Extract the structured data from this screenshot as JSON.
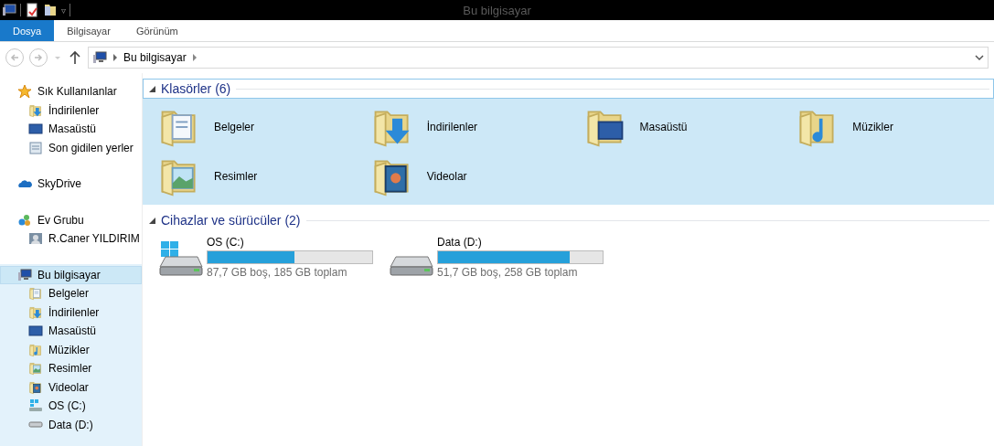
{
  "window": {
    "title": "Bu bilgisayar"
  },
  "quick_access": [
    "▿"
  ],
  "ribbon_tabs": [
    {
      "label": "Dosya",
      "selected": true
    },
    {
      "label": "Bilgisayar",
      "selected": false
    },
    {
      "label": "Görünüm",
      "selected": false
    }
  ],
  "address_bar": {
    "path": [
      "Bu bilgisayar"
    ]
  },
  "sidebar": {
    "sections": [
      {
        "label": "Sık Kullanılanlar",
        "kind": "star",
        "selected": false,
        "children": [
          {
            "label": "İndirilenler",
            "kind": "downloads",
            "selected": false
          },
          {
            "label": "Masaüstü",
            "kind": "desktop",
            "selected": false
          },
          {
            "label": "Son gidilen yerler",
            "kind": "recent",
            "selected": false
          }
        ]
      },
      {
        "label": "SkyDrive",
        "kind": "cloud",
        "selected": false
      },
      {
        "label": "Ev Grubu",
        "kind": "homegroup",
        "selected": false,
        "children": [
          {
            "label": "R.Caner YILDIRIM",
            "kind": "user",
            "selected": false
          }
        ]
      },
      {
        "label": "Bu bilgisayar",
        "kind": "computer",
        "selected": true,
        "children": [
          {
            "label": "Belgeler",
            "kind": "documents",
            "selected": false
          },
          {
            "label": "İndirilenler",
            "kind": "downloads",
            "selected": false
          },
          {
            "label": "Masaüstü",
            "kind": "desktop",
            "selected": false
          },
          {
            "label": "Müzikler",
            "kind": "music",
            "selected": false
          },
          {
            "label": "Resimler",
            "kind": "pictures",
            "selected": false
          },
          {
            "label": "Videolar",
            "kind": "videos",
            "selected": false
          },
          {
            "label": "OS (C:)",
            "kind": "windows-drive",
            "selected": false
          },
          {
            "label": "Data (D:)",
            "kind": "drive",
            "selected": false
          }
        ]
      }
    ]
  },
  "folders_group": {
    "title": "Klasörler (6)",
    "selected": true,
    "items": [
      {
        "label": "Belgeler",
        "kind": "documents",
        "selected": true
      },
      {
        "label": "İndirilenler",
        "kind": "downloads",
        "selected": true
      },
      {
        "label": "Masaüstü",
        "kind": "desktop",
        "selected": true
      },
      {
        "label": "Müzikler",
        "kind": "music",
        "selected": true
      },
      {
        "label": "Resimler",
        "kind": "pictures",
        "selected": true
      },
      {
        "label": "Videolar",
        "kind": "videos",
        "selected": true
      }
    ]
  },
  "drives_group": {
    "title": "Cihazlar ve sürücüler (2)",
    "selected": false,
    "items": [
      {
        "label": "OS (C:)",
        "kind": "windows-drive",
        "level": 0.53,
        "reading": "87,7 GB boş, 185 GB toplam",
        "selected": false
      },
      {
        "label": "Data (D:)",
        "kind": "drive",
        "level": 0.8,
        "reading": "51,7 GB boş, 258 GB toplam",
        "selected": false
      }
    ]
  }
}
